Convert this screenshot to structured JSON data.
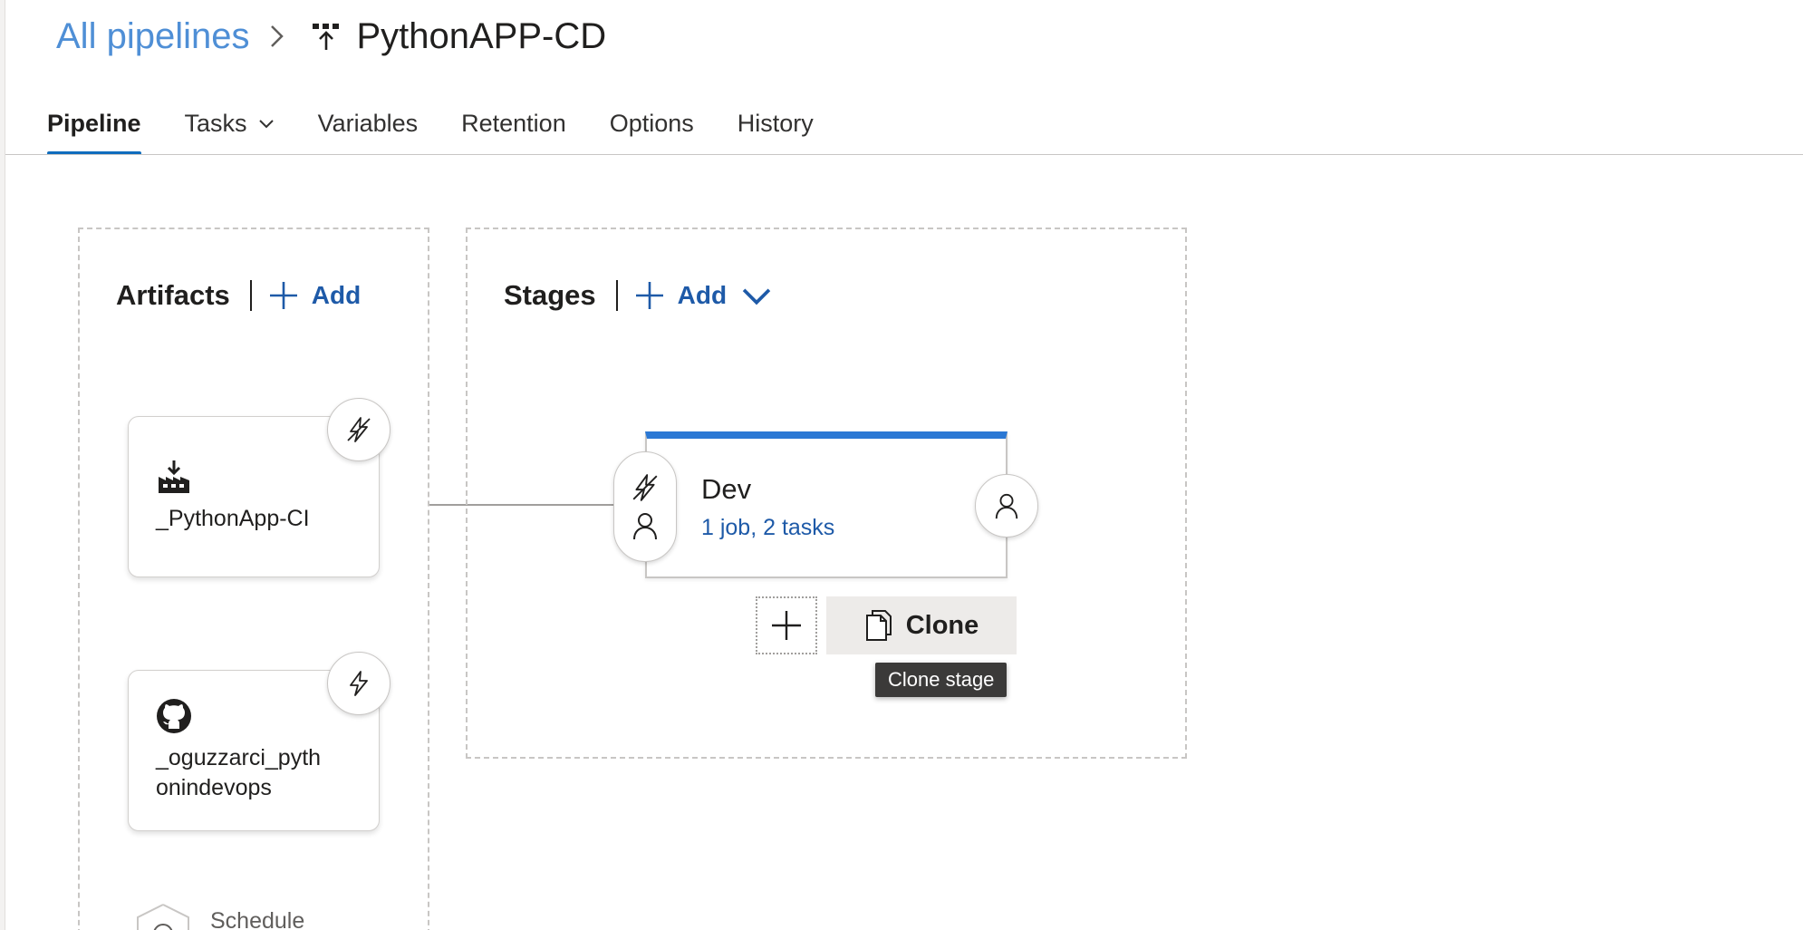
{
  "breadcrumb": {
    "root_label": "All pipelines",
    "separator_icon": "chevron-right-icon",
    "pipeline_icon": "release-pipeline-icon",
    "pipeline_title": "PythonAPP-CD"
  },
  "tabs": [
    {
      "label": "Pipeline",
      "active": true
    },
    {
      "label": "Tasks",
      "has_dropdown": true
    },
    {
      "label": "Variables"
    },
    {
      "label": "Retention"
    },
    {
      "label": "Options"
    },
    {
      "label": "History"
    }
  ],
  "artifacts": {
    "title": "Artifacts",
    "add_label": "Add",
    "items": [
      {
        "name": "_PythonApp-CI",
        "icon": "build-artifact-icon",
        "trigger_icon": "continuous-deployment-trigger-off-icon"
      },
      {
        "name": "_oguzzarci_pythonindevops",
        "icon": "github-icon",
        "trigger_icon": "continuous-deployment-trigger-icon"
      }
    ],
    "schedule": {
      "label": "Schedule",
      "icon": "schedule-icon"
    }
  },
  "stages": {
    "title": "Stages",
    "add_label": "Add",
    "items": [
      {
        "name": "Dev",
        "summary": "1 job, 2 tasks",
        "pre_icons": [
          "pre-deployment-trigger-icon",
          "pre-deployment-approvers-icon"
        ],
        "post_icon": "post-deployment-approvers-icon",
        "accent": "#2b78d4"
      }
    ],
    "add_stage_icon": "plus-icon",
    "clone_label": "Clone",
    "clone_icon": "copy-icon",
    "tooltip": "Clone stage"
  },
  "colors": {
    "link": "#4f8fd6",
    "accent": "#0f6cbd",
    "add_link": "#1e5aa8"
  }
}
